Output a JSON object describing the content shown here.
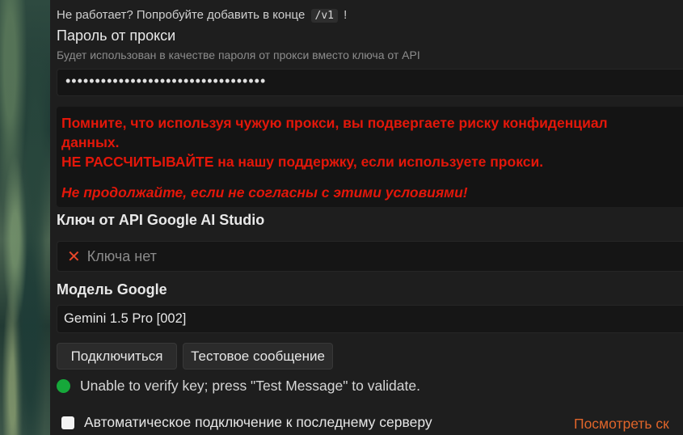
{
  "hint": {
    "prefix": "Не работает? Попробуйте добавить в конце",
    "code": "/v1",
    "suffix": "!"
  },
  "proxy_password": {
    "label": "Пароль от прокси",
    "description": "Будет использован в качестве пароля от прокси вместо ключа от API",
    "value": "••••••••••••••••••••••••••••••••••"
  },
  "warning": {
    "line1": "Помните, что используя чужую прокси, вы подвергаете риску конфиденциал",
    "line2": "данных.",
    "line3": "НЕ РАССЧИТЫВАЙТЕ на нашу поддержку, если используете прокси.",
    "line4": "Не продолжайте, если не согласны с этими условиями!",
    "color": "#e3170a"
  },
  "api_key": {
    "label": "Ключ от API Google AI Studio",
    "status_text": "Ключа нет",
    "icon": "x-icon"
  },
  "model": {
    "label": "Модель Google",
    "selected": "Gemini 1.5 Pro [002]"
  },
  "buttons": {
    "connect": "Подключиться",
    "test_message": "Тестовое сообщение"
  },
  "status": {
    "text": "Unable to verify key; press \"Test Message\" to validate.",
    "indicator_color": "#16a83a"
  },
  "auto_connect": {
    "label": "Автоматическое подключение к последнему серверу",
    "checked": false
  },
  "link": {
    "label": "Посмотреть ск",
    "color": "#e0652a"
  }
}
